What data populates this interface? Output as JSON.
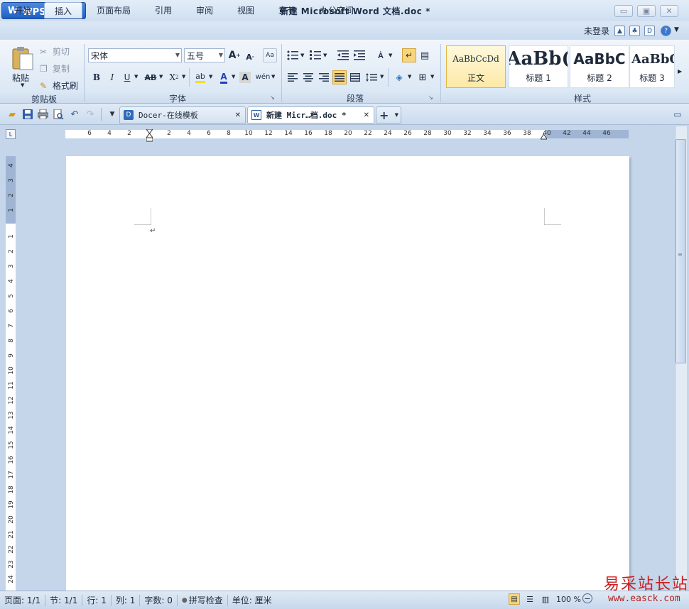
{
  "app": {
    "logo": "W",
    "name": "WPS 文字",
    "title": "新建 Microsoft Word 文档.doc *"
  },
  "window_controls": {
    "minimize": "▭",
    "maximize": "▣",
    "close": "✕"
  },
  "menu": {
    "tabs": [
      "开始",
      "插入",
      "页面布局",
      "引用",
      "审阅",
      "视图",
      "章节",
      "办公空间"
    ],
    "active": "插入",
    "login": "未登录"
  },
  "clipboard": {
    "paste": "粘贴",
    "cut": "剪切",
    "copy": "复制",
    "format_painter": "格式刷",
    "group": "剪贴板"
  },
  "font": {
    "name": "宋体",
    "size": "五号",
    "group": "字体",
    "grow": "A",
    "shrink": "A",
    "bold": "B",
    "italic": "I",
    "underline": "U",
    "strike": "AB",
    "superscript": "X",
    "highlight": "ab",
    "color": "A",
    "shade": "A",
    "pinyin": "wén"
  },
  "paragraph": {
    "group": "段落"
  },
  "styles": {
    "group": "样式",
    "items": [
      {
        "sample": "AaBbCcDd",
        "name": "正文"
      },
      {
        "sample": "AaBb(",
        "name": "标题 1"
      },
      {
        "sample": "AaBbC",
        "name": "标题 2"
      },
      {
        "sample": "AaBbC",
        "name": "标题 3"
      }
    ]
  },
  "doc_tabs": [
    {
      "label": "Docer-在线模板",
      "active": false
    },
    {
      "label": "新建 Micr…档.doc *",
      "active": true
    }
  ],
  "ruler": {
    "h_ticks": [
      "6",
      "4",
      "2",
      "",
      "2",
      "4",
      "6",
      "8",
      "10",
      "12",
      "14",
      "16",
      "18",
      "20",
      "22",
      "24",
      "26",
      "28",
      "30",
      "32",
      "34",
      "36",
      "38",
      "40",
      "42",
      "44",
      "46"
    ],
    "v_ticks_top": [
      "4",
      "3",
      "2",
      "1"
    ],
    "v_ticks": [
      "1",
      "2",
      "3",
      "4",
      "5",
      "6",
      "7",
      "8",
      "9",
      "10",
      "11",
      "12",
      "13",
      "14",
      "15",
      "16",
      "17",
      "18",
      "19",
      "20",
      "21",
      "22",
      "23",
      "24"
    ]
  },
  "status": {
    "page": "页面: 1/1",
    "section": "节: 1/1",
    "line": "行: 1",
    "column": "列: 1",
    "words": "字数: 0",
    "spell": "拼写检查",
    "unit": "单位: 厘米",
    "zoom": "100 %"
  },
  "watermark": {
    "cn": "易采站长站",
    "url": "www.easck.com"
  }
}
